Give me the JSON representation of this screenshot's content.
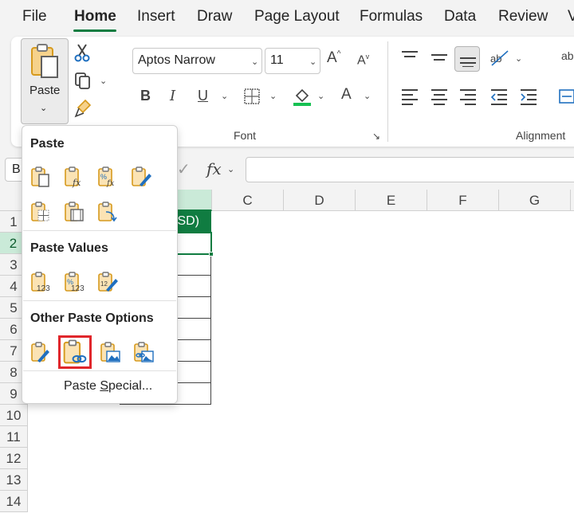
{
  "tabs": [
    "File",
    "Home",
    "Insert",
    "Draw",
    "Page Layout",
    "Formulas",
    "Data",
    "Review",
    "V"
  ],
  "active_tab": "Home",
  "clipboard": {
    "paste_label": "Paste"
  },
  "font": {
    "name": "Aptos Narrow",
    "size": "11",
    "group_label": "Font"
  },
  "alignment": {
    "group_label": "Alignment"
  },
  "formula_bar": {
    "name_box": "B",
    "fx": "fx"
  },
  "columns": [
    "C",
    "D",
    "E",
    "F",
    "G"
  ],
  "rows": [
    "1",
    "2",
    "3",
    "4",
    "5",
    "6",
    "7",
    "8",
    "9",
    "10",
    "11",
    "12",
    "13",
    "14"
  ],
  "cells": {
    "b1_partial": "ISD)"
  },
  "paste_menu": {
    "section_paste": "Paste",
    "section_values": "Paste Values",
    "section_other": "Other Paste Options",
    "special_pre": "Paste ",
    "special_u": "S",
    "special_post": "pecial..."
  },
  "colors": {
    "accent": "#107c41",
    "highlight": "#e0262b",
    "icon_gold": "#d69a1e",
    "icon_blue": "#1f6fbf"
  }
}
